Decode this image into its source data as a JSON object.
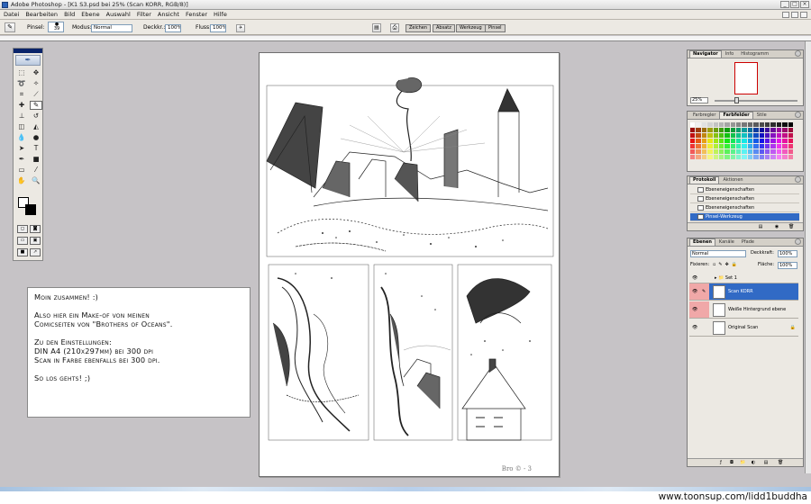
{
  "window": {
    "title": "Adobe Photoshop - [K1 S3.psd bei 25% (Scan KORR, RGB/8)]",
    "controls": [
      "_",
      "□",
      "×"
    ]
  },
  "menu": [
    "Datei",
    "Bearbeiten",
    "Bild",
    "Ebene",
    "Auswahl",
    "Filter",
    "Ansicht",
    "Fenster",
    "Hilfe"
  ],
  "options": {
    "brush_label": "Pinsel:",
    "brush_size": "39",
    "mode_label": "Modus:",
    "mode_value": "Normal",
    "opacity_label": "Deckkr.:",
    "opacity_value": "100%",
    "flow_label": "Fluss:",
    "flow_value": "100%",
    "well_tabs": [
      "Zeichen",
      "Absatz",
      "Werkzeug",
      "Pinsel"
    ]
  },
  "navigator": {
    "tabs": [
      "Navigator",
      "Info",
      "Histogramm"
    ],
    "zoom": "25%"
  },
  "color_palette": {
    "tabs": [
      "Farbregler",
      "Farbfelder",
      "Stile"
    ]
  },
  "history": {
    "tabs": [
      "Protokoll",
      "Aktionen"
    ],
    "items": [
      "Ebeneneigenschaften",
      "Ebeneneigenschaften",
      "Ebeneneigenschaften",
      "Pinsel-Werkzeug"
    ]
  },
  "layers": {
    "tabs": [
      "Ebenen",
      "Kanäle",
      "Pfade"
    ],
    "blend_mode": "Normal",
    "opacity_label": "Deckkraft:",
    "opacity_value": "100%",
    "lock_label": "Fixieren:",
    "fill_label": "Fläche:",
    "fill_value": "100%",
    "set_name": "Set 1",
    "items": [
      {
        "name": "Scan KORR",
        "selected": true
      },
      {
        "name": "Weiße Hintergrund ebene",
        "selected": false
      },
      {
        "name": "Original Scan",
        "selected": false
      }
    ]
  },
  "note": {
    "text": "Moin zusammen! :)\n\nAlso hier ein Make-of von meinen\nComicseiten von \"Brothers of Oceans\".\n\nZu den Einstellungen:\nDIN A4 (210x297mm) bei 300 dpi\nScan in Farbe ebenfalls bei 300 dpi.\n\nSo los gehts! ;)"
  },
  "document": {
    "signature": "Bro ©  - 3"
  },
  "watermark": "www.toonsup.com/lidd1buddha",
  "colors": {
    "selection": "#316ac5",
    "chrome": "#ece9e3",
    "workspace": "#c6c3c6",
    "layer_link_pink": "#f0a8a8"
  }
}
